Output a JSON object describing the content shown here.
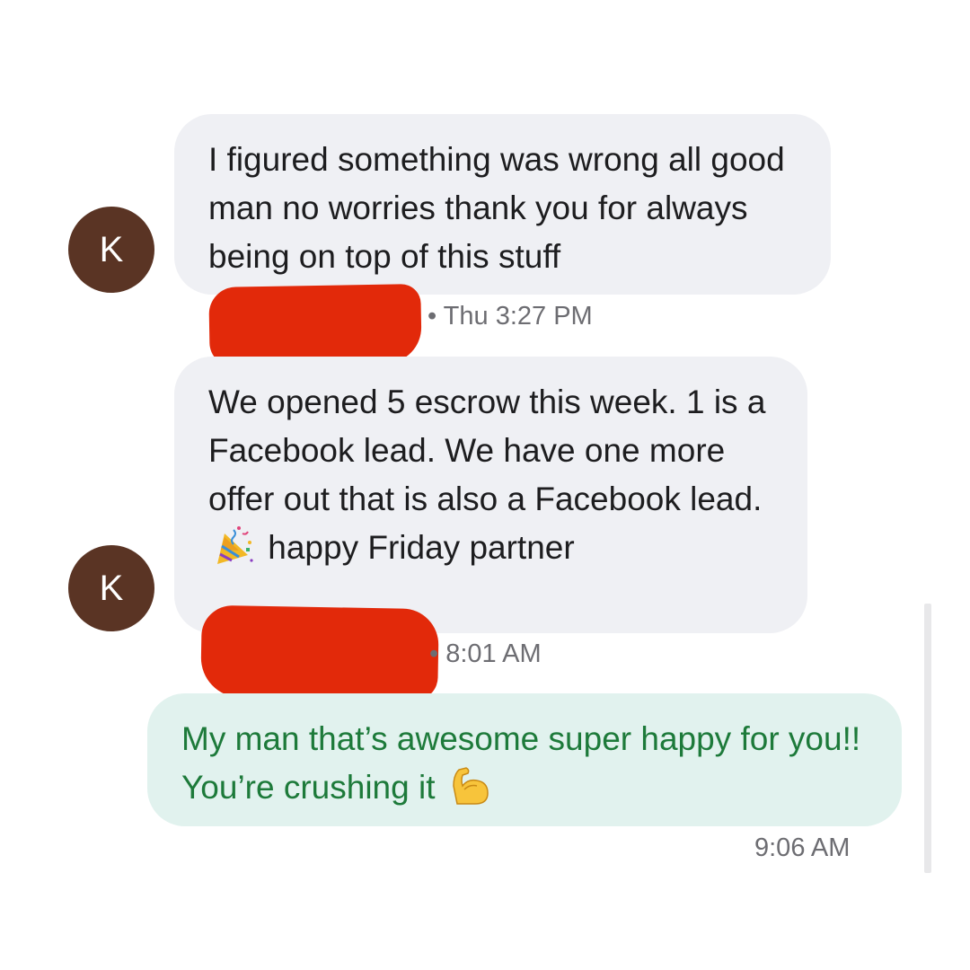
{
  "conversation": {
    "messages": [
      {
        "sender_initial": "K",
        "text": "I figured something was wrong all good man no worries thank you for always being on top of this stuff",
        "meta": "• Thu 3:27 PM"
      },
      {
        "sender_initial": "K",
        "text_before_emoji": "We opened 5 escrow this week. 1 is a Facebook lead. We have one more offer out that is also a Facebook lead.",
        "emoji_icon": "party-popper-icon",
        "text_after_emoji": "happy Friday partner",
        "meta": "• 8:01 AM"
      },
      {
        "text_before_emoji": "My man that’s awesome super happy for you!! You’re crushing it",
        "emoji_icon": "flexed-biceps-icon",
        "meta": "9:06 AM"
      }
    ]
  },
  "colors": {
    "incoming_bubble": "#eff0f4",
    "outgoing_bubble": "#e1f2ee",
    "outgoing_text": "#1d7a3a",
    "avatar": "#5a3424",
    "redaction": "#e2290a"
  }
}
